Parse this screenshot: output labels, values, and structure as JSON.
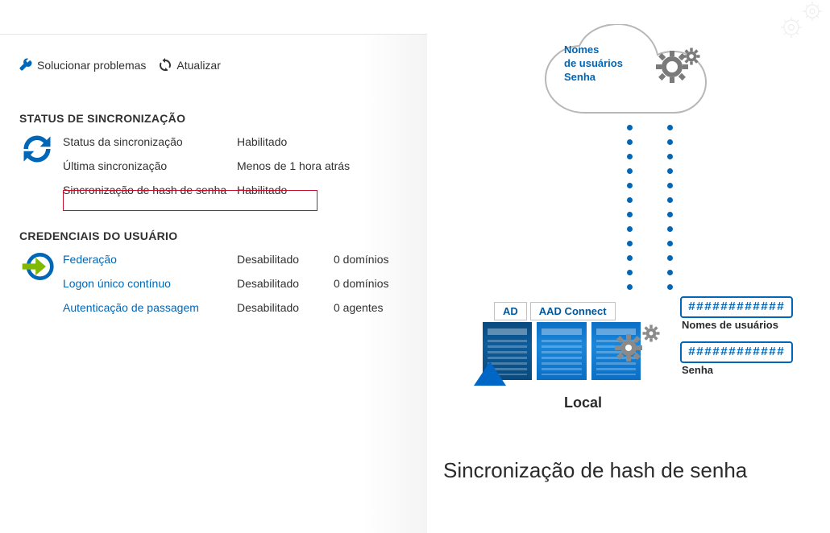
{
  "toolbar": {
    "troubleshoot": "Solucionar problemas",
    "refresh": "Atualizar"
  },
  "sync": {
    "header": "STATUS DE SINCRONIZAÇÃO",
    "rows": [
      {
        "label": "Status da sincronização",
        "value": "Habilitado"
      },
      {
        "label": "Última sincronização",
        "value": "Menos de 1 hora atrás"
      },
      {
        "label": "Sincronização de hash de senha",
        "value": "Habilitado"
      }
    ]
  },
  "creds": {
    "header": "CREDENCIAIS DO USUÁRIO",
    "rows": [
      {
        "label": "Federação",
        "value": "Desabilitado",
        "extra": "0 domínios"
      },
      {
        "label": "Logon único contínuo",
        "value": "Desabilitado",
        "extra": "0 domínios"
      },
      {
        "label": "Autenticação de passagem",
        "value": "Desabilitado",
        "extra": "0 agentes"
      }
    ]
  },
  "diagram": {
    "cloud_line1": "Nomes",
    "cloud_line2": "de usuários",
    "cloud_line3": "Senha",
    "server_tag1": "AD",
    "server_tag2": "AAD Connect",
    "hash_text": "############",
    "username_label": "Nomes de usuários",
    "password_label": "Senha",
    "local_label": "Local",
    "title": "Sincronização de hash de senha"
  }
}
